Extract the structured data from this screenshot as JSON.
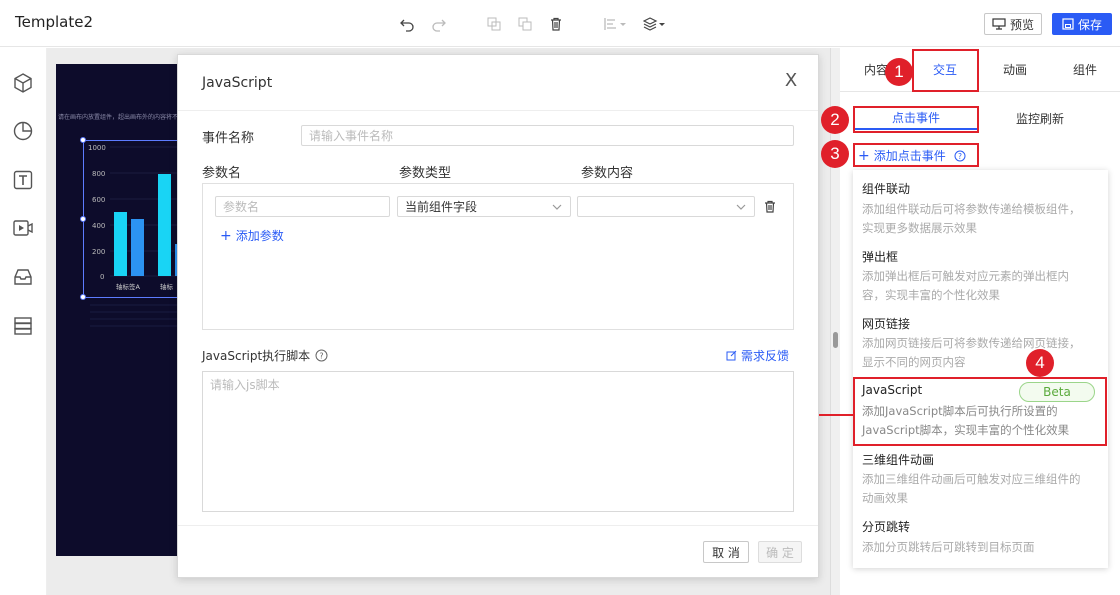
{
  "app": {
    "title": "Template2"
  },
  "toolbar": {
    "preview_label": "预览",
    "save_label": "保存"
  },
  "canvas": {
    "hint": "请在画布内放置组件，超出画布外的内容将不显示",
    "chart_ticks": [
      "1000",
      "800",
      "600",
      "400",
      "200",
      "0"
    ],
    "chart_labels": [
      "轴标签A",
      "轴标"
    ]
  },
  "dialog": {
    "title": "JavaScript",
    "close": "X",
    "event_name_label": "事件名称",
    "event_name_placeholder": "请输入事件名称",
    "col_param_name": "参数名",
    "col_param_type": "参数类型",
    "col_param_content": "参数内容",
    "param_name_placeholder": "参数名",
    "param_type_value": "当前组件字段",
    "add_param": "添加参数",
    "script_label": "JavaScript执行脚本",
    "feedback": "需求反馈",
    "script_placeholder": "请输入js脚本",
    "cancel": "取 消",
    "confirm": "确 定"
  },
  "panel": {
    "tabs": [
      "内容",
      "交互",
      "动画",
      "组件"
    ],
    "subtabs": [
      "点击事件",
      "监控刷新"
    ],
    "add_event": "添加点击事件",
    "menu": [
      {
        "title": "组件联动",
        "desc": "添加组件联动后可将参数传递给模板组件，实现更多数据展示效果"
      },
      {
        "title": "弹出框",
        "desc": "添加弹出框后可触发对应元素的弹出框内容，实现丰富的个性化效果"
      },
      {
        "title": "网页链接",
        "desc": "添加网页链接后可将参数传递给网页链接，显示不同的网页内容"
      },
      {
        "title": "JavaScript",
        "desc": "添加JavaScript脚本后可执行所设置的JavaScript脚本，实现丰富的个性化效果",
        "badge": "Beta"
      },
      {
        "title": "三维组件动画",
        "desc": "添加三维组件动画后可触发对应三维组件的动画效果"
      },
      {
        "title": "分页跳转",
        "desc": "添加分页跳转后可跳转到目标页面"
      }
    ]
  },
  "markers": [
    "1",
    "2",
    "3",
    "4"
  ],
  "colors": {
    "accent": "#2a5bf5",
    "highlight": "#e0202a",
    "beta": "#5aaa3c"
  }
}
